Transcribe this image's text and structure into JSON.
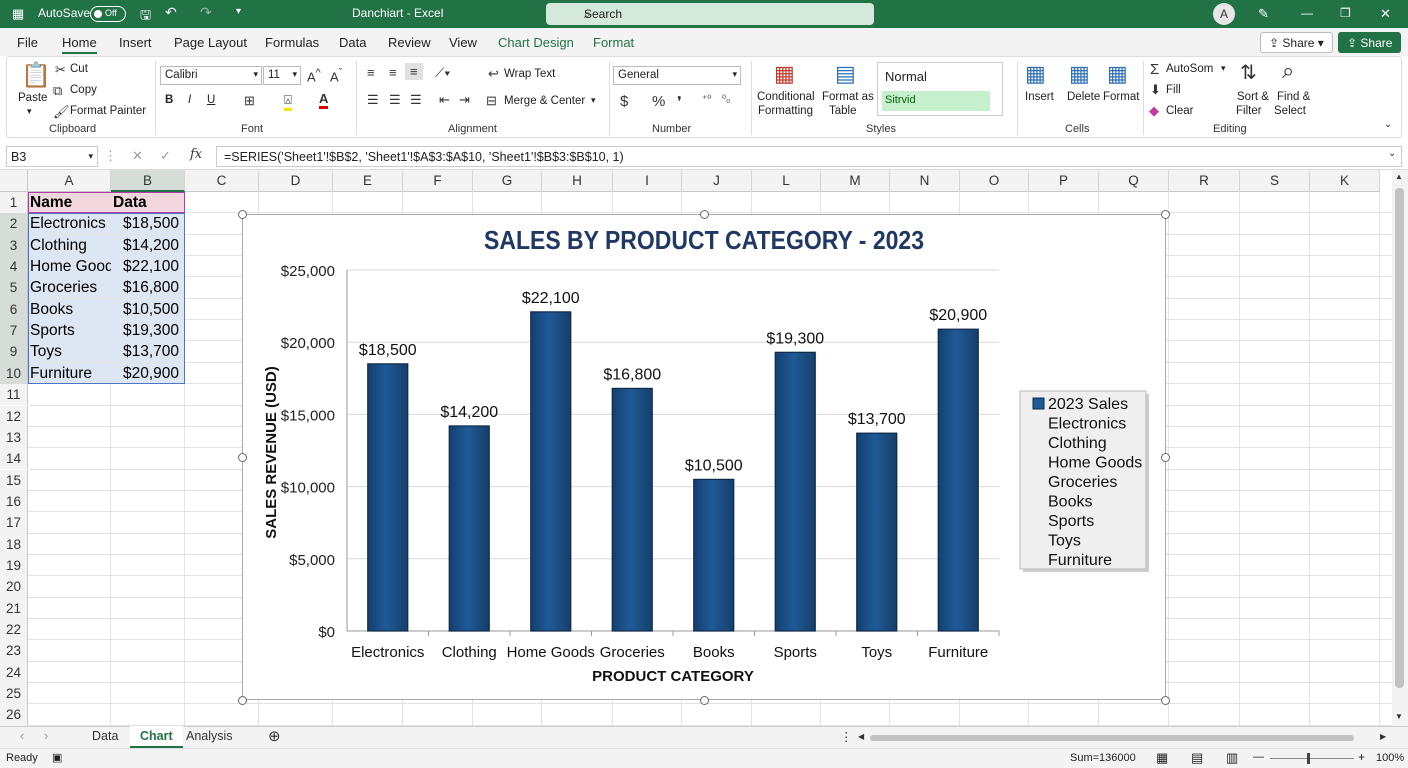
{
  "title_bar": {
    "autosave_label": "AutoSave",
    "autosave_state": "Off",
    "doc_title": "Danchiart - Excel",
    "search_placeholder": "Search",
    "user_initial": "A"
  },
  "menu": [
    "File",
    "Home",
    "Insert",
    "Page Layout",
    "Formulas",
    "Data",
    "Review",
    "View",
    "Chart Design",
    "Format"
  ],
  "active_menu": "Home",
  "share_labels": [
    "Share",
    "Share"
  ],
  "ribbon": {
    "clipboard": {
      "paste": "Paste",
      "cut": "Cut",
      "copy": "Copy",
      "format_painter": "Format Painter",
      "group": "Clipboard"
    },
    "font": {
      "name": "Calibri",
      "size": "11",
      "group": "Font",
      "bold": "B",
      "italic": "I",
      "underline": "U"
    },
    "alignment": {
      "wrap": "Wrap Text",
      "merge": "Merge & Center",
      "group": "Alignment"
    },
    "number": {
      "format": "General",
      "group": "Number",
      "currency": "$",
      "percent": "%"
    },
    "styles": {
      "conditional": "Conditional",
      "conditional2": "Formatting",
      "format_as": "Format as",
      "format_as2": "Table",
      "normal": "Normal",
      "style2": "Sitrvid",
      "group": "Styles"
    },
    "cells": {
      "insert": "Insert",
      "delete": "Delete",
      "format": "Format",
      "group": "Cells"
    },
    "editing": {
      "autosum": "AutoSom",
      "fill": "Fill",
      "clear": "Clear",
      "sort": "Sort &",
      "sort2": "Filter",
      "find": "Find &",
      "find2": "Select",
      "group": "Editing"
    }
  },
  "formula_bar": {
    "name_box": "B3",
    "formula": "=SERIES('Sheet1'!$B$2, 'Sheet1'!$A$3:$A$10, 'Sheet1'!$B$3:$B$10, 1)"
  },
  "columns": [
    "A",
    "B",
    "C",
    "D",
    "E",
    "F",
    "G",
    "H",
    "I",
    "J",
    "L",
    "M",
    "N",
    "O",
    "P",
    "Q",
    "R",
    "S",
    "K"
  ],
  "rows": [
    "1",
    "2",
    "3",
    "4",
    "5",
    "6",
    "7",
    "9",
    "10",
    "11",
    "12",
    "13",
    "14",
    "15",
    "16",
    "17",
    "18",
    "19",
    "20",
    "21",
    "22",
    "23",
    "24",
    "25",
    "26"
  ],
  "table": {
    "headers": [
      "Name",
      "Data"
    ],
    "rows": [
      [
        "Electronics",
        "$18,500"
      ],
      [
        "Clothing",
        "$14,200"
      ],
      [
        "Home Goods",
        "$22,100"
      ],
      [
        "Groceries",
        "$16,800"
      ],
      [
        "Books",
        "$10,500"
      ],
      [
        "Sports",
        "$19,300"
      ],
      [
        "Toys",
        "$13,700"
      ],
      [
        "Furniture",
        "$20,900"
      ]
    ]
  },
  "chart_data": {
    "type": "bar",
    "title": "SALES BY PRODUCT CATEGORY - 2023",
    "xlabel": "PRODUCT CATEGORY",
    "ylabel": "SALES REVENUE (USD)",
    "categories": [
      "Electronics",
      "Clothing",
      "Home Goods",
      "Groceries",
      "Books",
      "Sports",
      "Toys",
      "Furniture"
    ],
    "series": [
      {
        "name": "2023 Sales",
        "values": [
          18500,
          14200,
          22100,
          16800,
          10500,
          19300,
          13700,
          20900
        ]
      }
    ],
    "data_labels": [
      "$18,500",
      "$14,200",
      "$22,100",
      "$16,800",
      "$10,500",
      "$19,300",
      "$13,700",
      "$20,900"
    ],
    "yticks": [
      "$0",
      "$5,000",
      "$10,000",
      "$15,000",
      "$20,000",
      "$25,000"
    ],
    "ylim": [
      0,
      25000
    ],
    "legend_entries": [
      "2023 Sales",
      "Electronics",
      "Clothing",
      "Home Goods",
      "Groceries",
      "Books",
      "Sports",
      "Toys",
      "Furniture"
    ],
    "legend_position": "right",
    "bar_color": "#1f5a96",
    "grid": true
  },
  "sheet_tabs": [
    "Data",
    "Chart",
    "Analysis"
  ],
  "active_tab": "Chart",
  "status": {
    "ready": "Ready",
    "sum": "Sum=136000",
    "zoom": "100%"
  },
  "colors": {
    "accent": "#217346",
    "header_fill": "#f2d7df",
    "data_fill": "#dde7f4"
  }
}
